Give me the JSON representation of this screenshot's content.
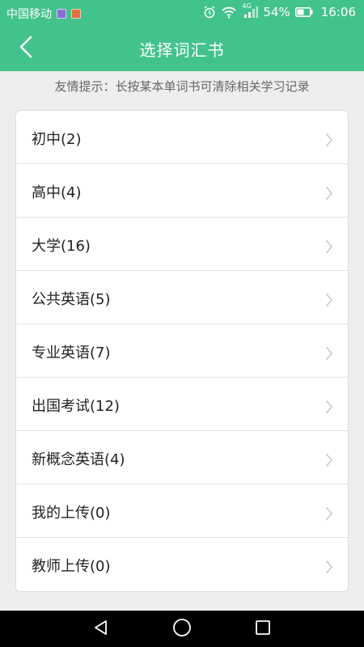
{
  "status_bar": {
    "carrier": "中国移动",
    "network_label": "4G",
    "battery": "54%",
    "time": "16:06"
  },
  "header": {
    "title": "选择词汇书"
  },
  "tip": "友情提示：长按某本单词书可清除相关学习记录",
  "books": [
    {
      "label": "初中(2)"
    },
    {
      "label": "高中(4)"
    },
    {
      "label": "大学(16)"
    },
    {
      "label": "公共英语(5)"
    },
    {
      "label": "专业英语(7)"
    },
    {
      "label": "出国考试(12)"
    },
    {
      "label": "新概念英语(4)"
    },
    {
      "label": "我的上传(0)"
    },
    {
      "label": "教师上传(0)"
    }
  ],
  "colors": {
    "primary": "#43c38c",
    "background": "#eeeeee",
    "card": "#ffffff",
    "nav_bar": "#000000"
  },
  "icons": {
    "back": "chevron-left-icon",
    "row": "chevron-right-icon",
    "alarm": "alarm-icon",
    "wifi": "wifi-icon",
    "signal": "signal-icon",
    "battery": "battery-icon",
    "nav_back": "triangle-back-icon",
    "nav_home": "circle-home-icon",
    "nav_recent": "square-recent-icon"
  }
}
